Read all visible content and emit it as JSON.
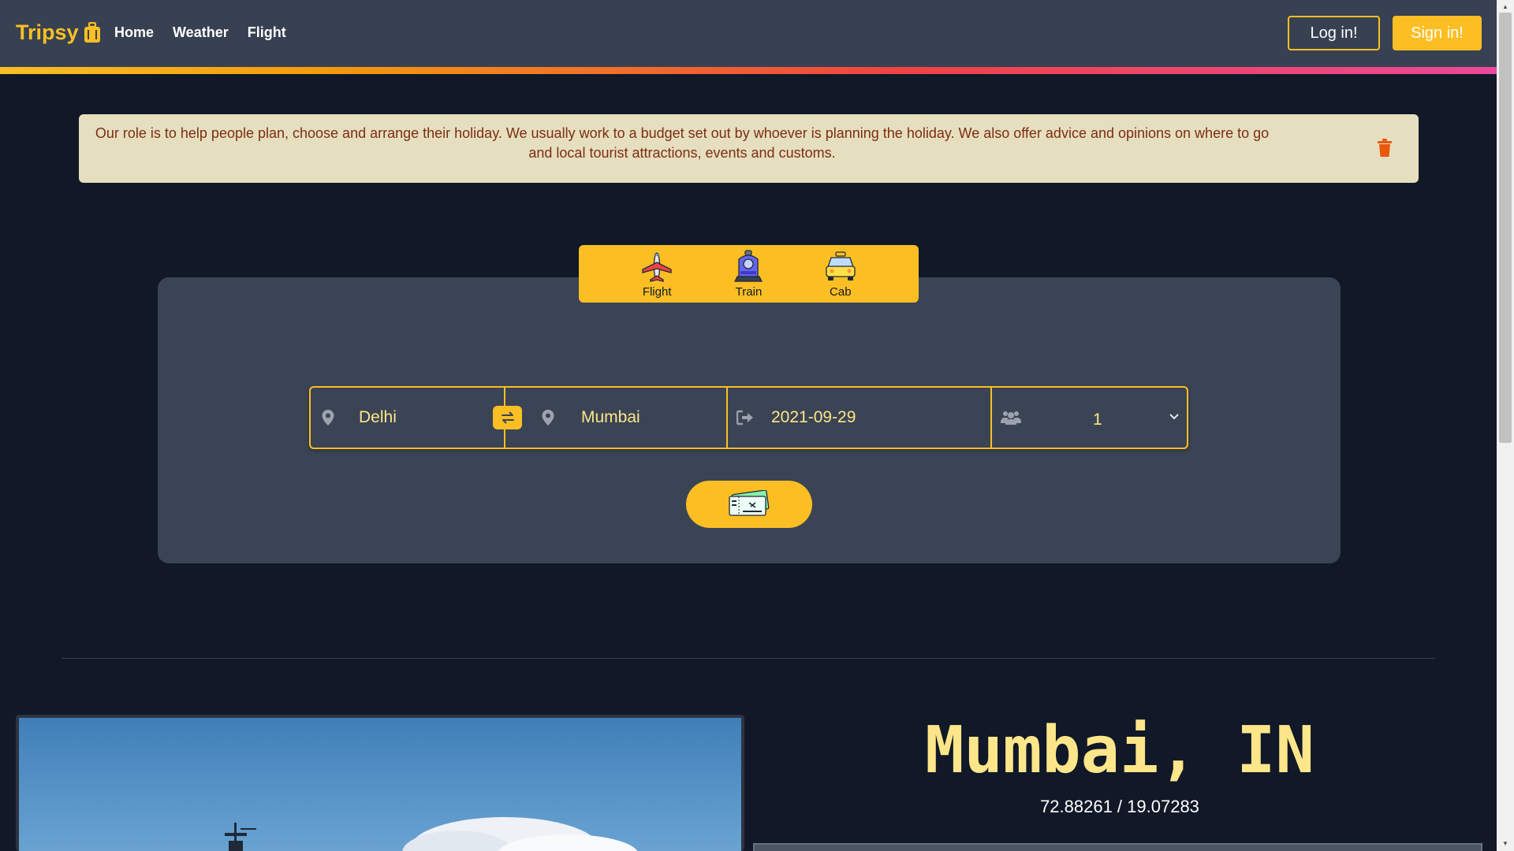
{
  "nav": {
    "brand": "Tripsy",
    "brand_icon": "suitcase-icon",
    "links": [
      "Home",
      "Weather",
      "Flight"
    ],
    "login_label": "Log in!",
    "signin_label": "Sign in!"
  },
  "alert": {
    "text": "Our role is to help people plan, choose and arrange their holiday. We usually work to a budget set out by whoever is planning the holiday. We also offer advice and opinions on where to go and local tourist attractions, events and customs.",
    "close_icon": "trash-icon"
  },
  "modes": [
    {
      "label": "Flight",
      "icon": "airplane-icon"
    },
    {
      "label": "Train",
      "icon": "train-icon"
    },
    {
      "label": "Cab",
      "icon": "taxi-icon"
    }
  ],
  "search": {
    "from": "Delhi",
    "to": "Mumbai",
    "date": "2021-09-29",
    "passengers": "1",
    "submit_icon": "tickets-icon"
  },
  "city": {
    "title": "Mumbai, IN",
    "coords": "72.88261 / 19.07283"
  },
  "colors": {
    "accent": "#fbbf24",
    "background": "#111827",
    "navbar": "#374151",
    "panel": "#3b4454",
    "alert_bg": "#e6dfbf",
    "alert_text": "#7c2d12",
    "city_title": "#fde68a"
  }
}
